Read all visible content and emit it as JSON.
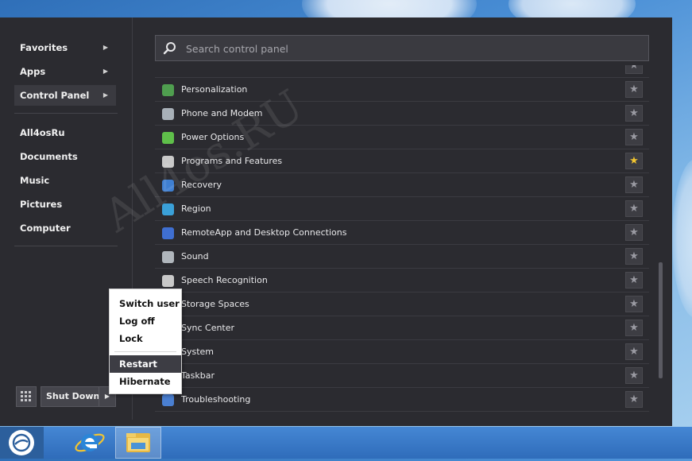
{
  "sidebar": {
    "top_items": [
      {
        "label": "Favorites",
        "arrow": "▶"
      },
      {
        "label": "Apps",
        "arrow": "▶"
      },
      {
        "label": "Control Panel",
        "arrow": "▶"
      }
    ],
    "places": [
      "All4osRu",
      "Documents",
      "Music",
      "Pictures",
      "Computer"
    ]
  },
  "search": {
    "placeholder": "Search control panel",
    "value": ""
  },
  "control_panel_items": [
    {
      "label": "Personalization",
      "favorite": false,
      "icon": "personalization-icon",
      "color": "#4f9e4f"
    },
    {
      "label": "Phone and Modem",
      "favorite": false,
      "icon": "phone-icon",
      "color": "#a8b0b8"
    },
    {
      "label": "Power Options",
      "favorite": false,
      "icon": "power-icon",
      "color": "#5fbf4a"
    },
    {
      "label": "Programs and Features",
      "favorite": true,
      "icon": "programs-icon",
      "color": "#c9c9c9"
    },
    {
      "label": "Recovery",
      "favorite": false,
      "icon": "recovery-icon",
      "color": "#3f7fd1"
    },
    {
      "label": "Region",
      "favorite": false,
      "icon": "region-icon",
      "color": "#3aa0d8"
    },
    {
      "label": "RemoteApp and Desktop Connections",
      "favorite": false,
      "icon": "remoteapp-icon",
      "color": "#3f6fd1"
    },
    {
      "label": "Sound",
      "favorite": false,
      "icon": "sound-icon",
      "color": "#b0b6bc"
    },
    {
      "label": "Speech Recognition",
      "favorite": false,
      "icon": "microphone-icon",
      "color": "#c8c8c8"
    },
    {
      "label": "Storage Spaces",
      "favorite": false,
      "icon": "storage-icon",
      "color": "#8a8a8a"
    },
    {
      "label": "Sync Center",
      "favorite": false,
      "icon": "sync-icon",
      "color": "#4ca84c"
    },
    {
      "label": "System",
      "favorite": false,
      "icon": "system-icon",
      "color": "#5a8fd0"
    },
    {
      "label": "Taskbar",
      "favorite": false,
      "icon": "taskbar-icon",
      "color": "#7a9fcf"
    },
    {
      "label": "Troubleshooting",
      "favorite": false,
      "icon": "troubleshooting-icon",
      "color": "#4a7fd1"
    }
  ],
  "star_glyph": "★",
  "power": {
    "shutdown_label": "Shut Down",
    "arrow": "▶",
    "menu": [
      "Switch user",
      "Log off",
      "Lock",
      "Restart",
      "Hibernate"
    ],
    "highlighted": "Restart"
  },
  "watermark": "All4os.RU"
}
